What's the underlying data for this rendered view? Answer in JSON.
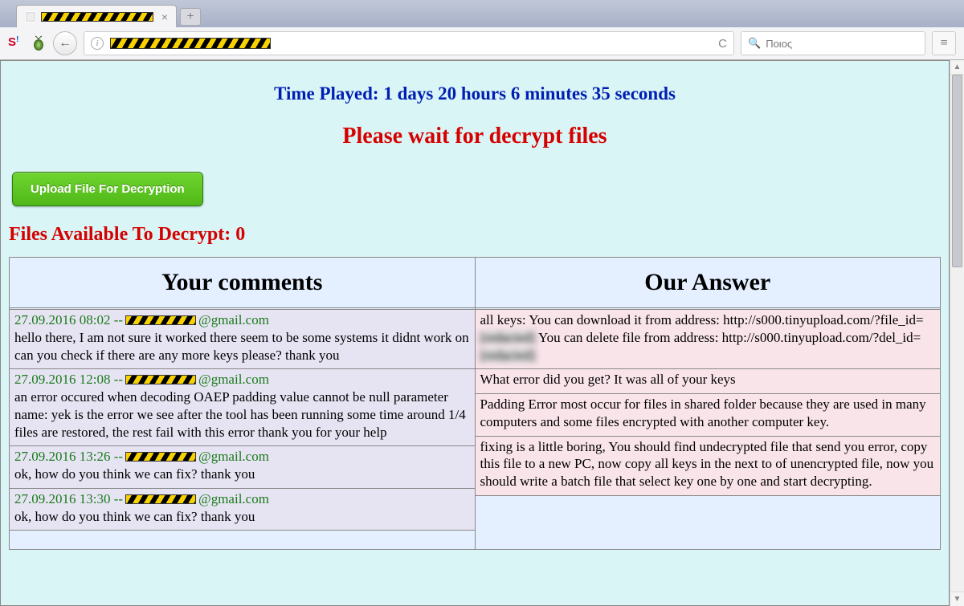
{
  "browser": {
    "tab_title_hidden": true,
    "new_tab_label": "+",
    "back_label": "←",
    "url_hidden": true,
    "refresh_label": "C",
    "search_placeholder": "Ποιος",
    "hamburger_label": "≡"
  },
  "page": {
    "time_played_prefix": "Time Played: ",
    "time_played_value": "1 days 20 hours 6 minutes 35 seconds",
    "wait_message": "Please wait for decrypt files",
    "upload_button": "Upload File For Decryption",
    "files_available_prefix": "Files Available To Decrypt: ",
    "files_available_count": "0",
    "columns": {
      "left_header": "Your comments",
      "right_header": "Our Answer"
    },
    "comments": [
      {
        "timestamp": "27.09.2016 08:02 --",
        "email_suffix": "@gmail.com",
        "body": "hello there, I am not sure it worked there seem to be some systems it didnt work on can you check if there are any more keys please? thank you"
      },
      {
        "timestamp": "27.09.2016 12:08 --",
        "email_suffix": "@gmail.com",
        "body": "an error occured when decoding OAEP padding value cannot be null parameter name: yek is the error we see after the tool has been running some time around 1/4 files are restored, the rest fail with this error thank you for your help"
      },
      {
        "timestamp": "27.09.2016 13:26 --",
        "email_suffix": "@gmail.com",
        "body": "ok, how do you think we can fix? thank you"
      },
      {
        "timestamp": "27.09.2016 13:30 --",
        "email_suffix": "@gmail.com",
        "body": "ok, how do you think we can fix? thank you"
      }
    ],
    "answers": [
      {
        "body_parts": [
          "all keys: You can download it from address: http://s000.tinyupload.com/?file_id=",
          "[redacted]",
          " You can delete file from address: http://s000.tinyupload.com/?del_id=",
          "[redacted]"
        ]
      },
      {
        "body": "What error did you get? It was all of your keys"
      },
      {
        "body": "Padding Error most occur for files in shared folder because they are used in many computers and some files encrypted with another computer key."
      },
      {
        "body": "fixing is a little boring, You should find undecrypted file that send you error, copy this file to a new PC, now copy all keys in the next to of unencrypted file, now you should write a batch file that select key one by one and start decrypting."
      }
    ]
  }
}
